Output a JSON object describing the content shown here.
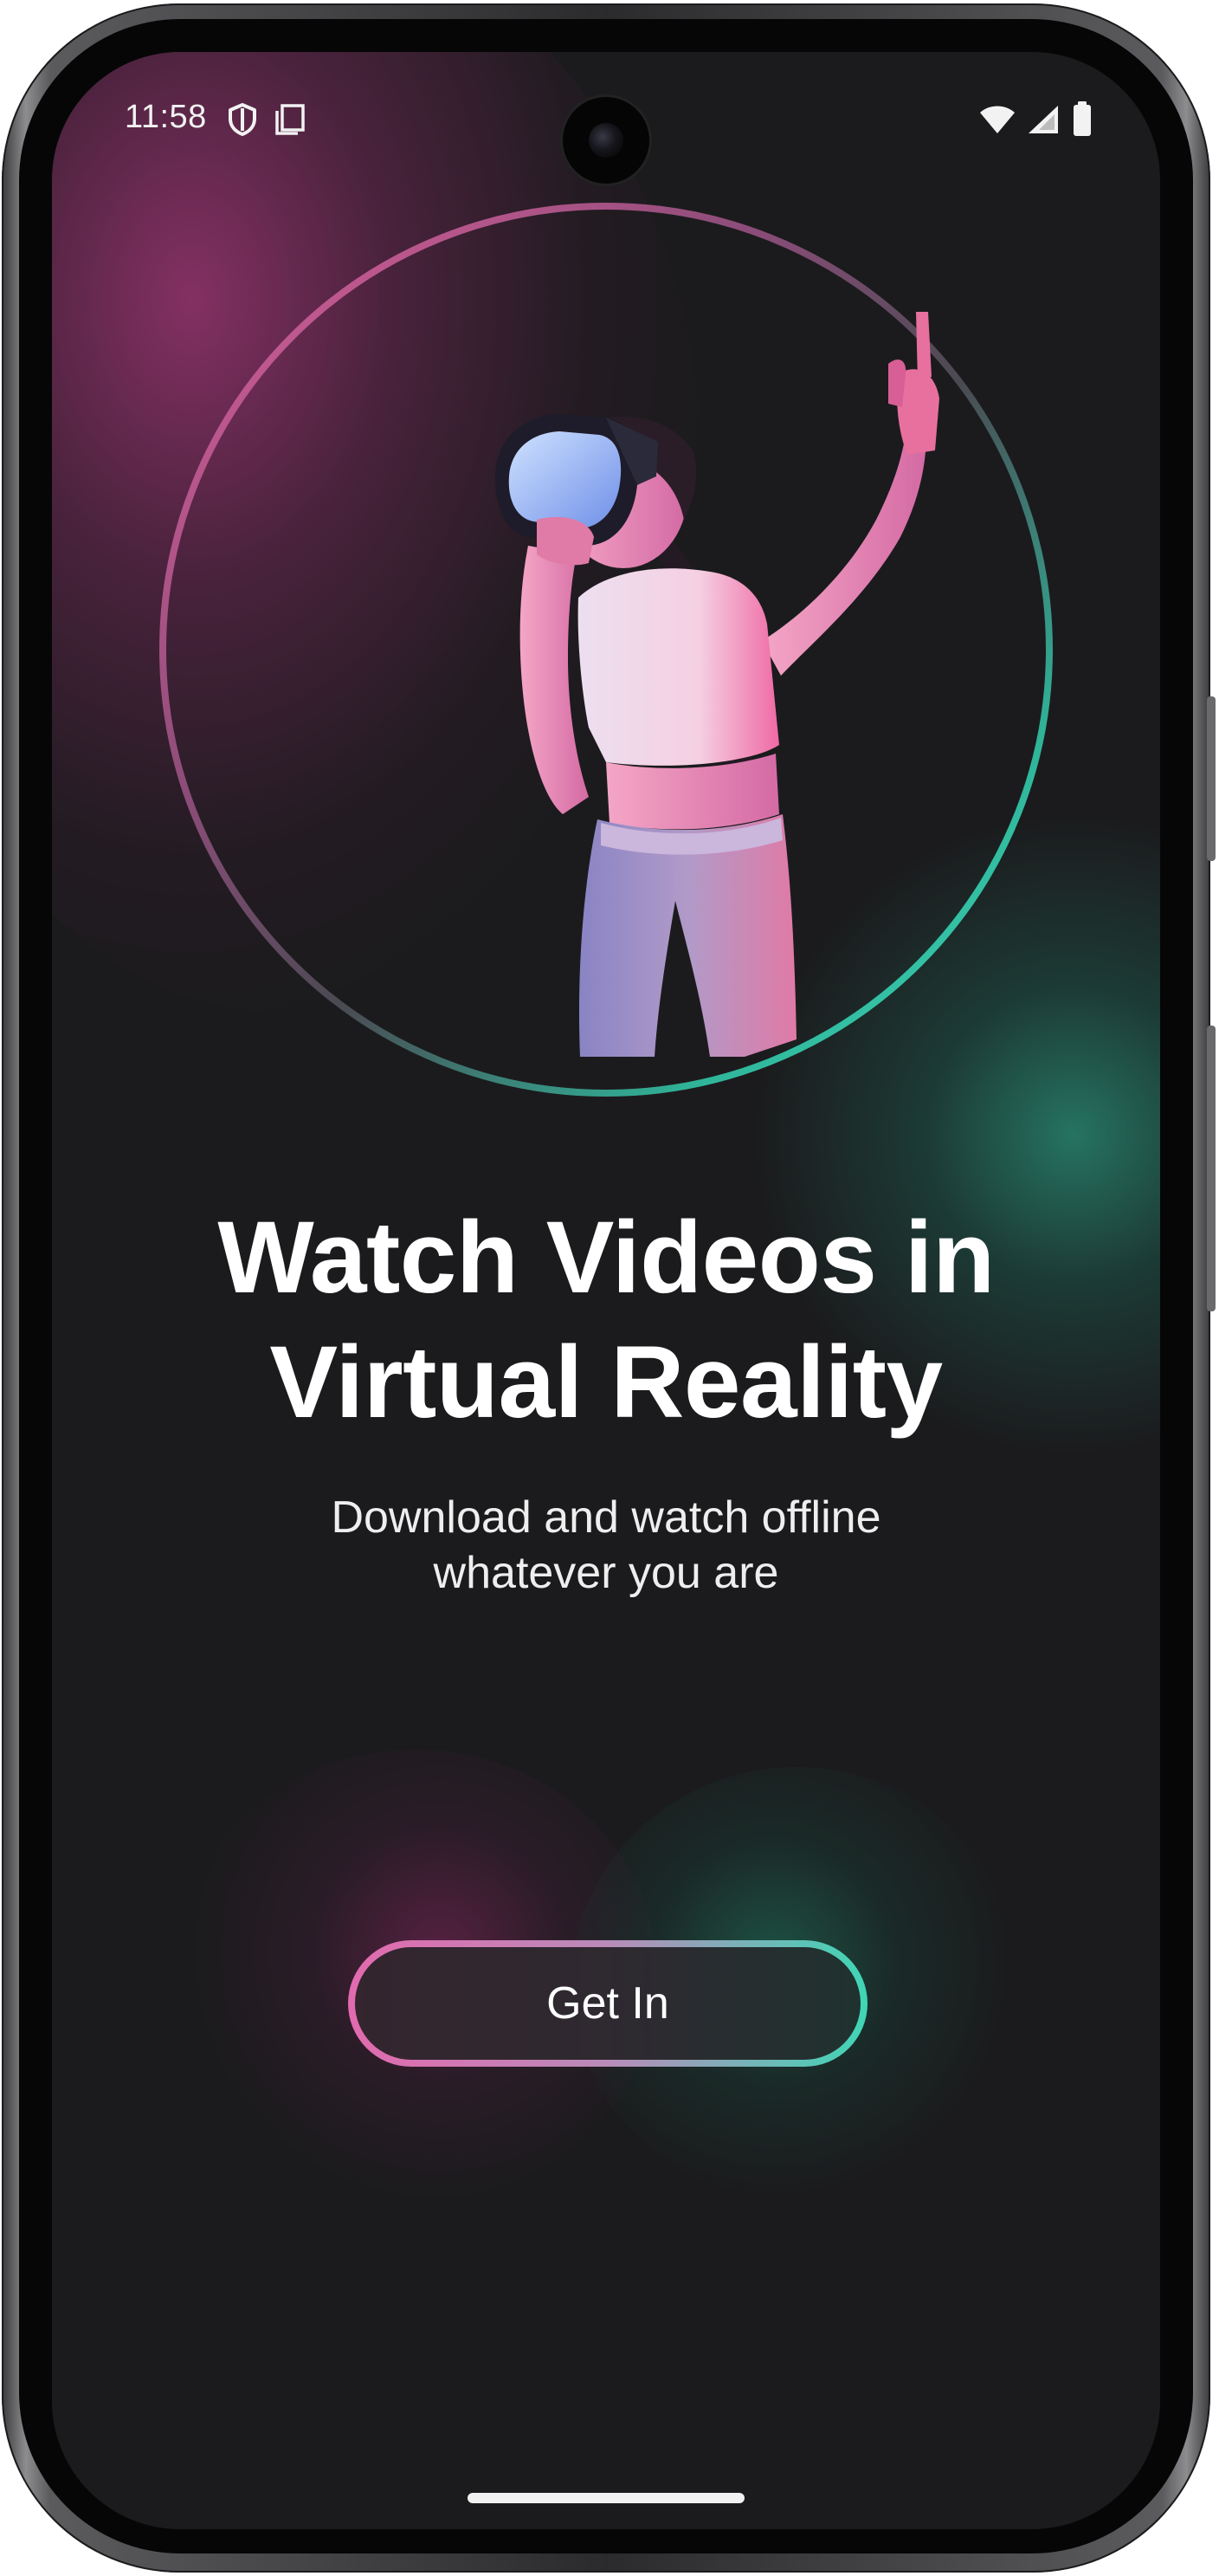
{
  "status_bar": {
    "time": "11:58",
    "left_icons": [
      "shield-icon",
      "screenshot-icon"
    ],
    "right_icons": [
      "wifi-icon",
      "cellular-signal-icon",
      "battery-icon"
    ]
  },
  "hero": {
    "image": "woman-vr-headset-illustration"
  },
  "onboarding": {
    "title_line1": "Watch Videos in",
    "title_line2": "Virtual Reality",
    "subtitle_line1": "Download and watch offline",
    "subtitle_line2": "whatever you are",
    "button_label": "Get In"
  },
  "colors": {
    "background": "#1b1b1d",
    "accent_pink": "#e26aae",
    "accent_teal": "#3fd6b6",
    "text": "#ffffff"
  }
}
